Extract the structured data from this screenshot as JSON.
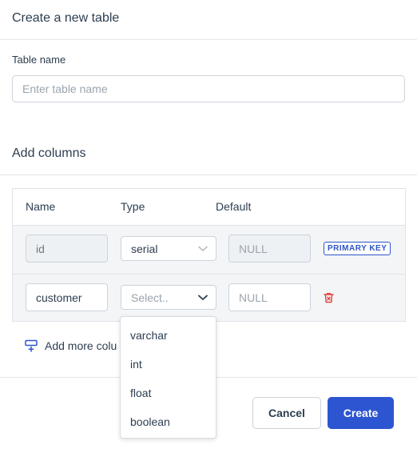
{
  "dialog": {
    "title": "Create a new table"
  },
  "table_name": {
    "label": "Table name",
    "placeholder": "Enter table name",
    "value": ""
  },
  "columns_section": {
    "title": "Add columns",
    "headers": {
      "name": "Name",
      "type": "Type",
      "default": "Default"
    },
    "rows": [
      {
        "name": "id",
        "type": "serial",
        "default_placeholder": "NULL",
        "badge": "PRIMARY KEY"
      },
      {
        "name": "customer",
        "type_placeholder": "Select..",
        "default_placeholder": "NULL"
      }
    ],
    "add_more_label": "Add more colu"
  },
  "type_dropdown": {
    "options": [
      "varchar",
      "int",
      "float",
      "boolean"
    ]
  },
  "footer": {
    "cancel_label": "Cancel",
    "create_label": "Create"
  },
  "colors": {
    "primary": "#2d55d1",
    "delete_icon": "#e0403a"
  }
}
